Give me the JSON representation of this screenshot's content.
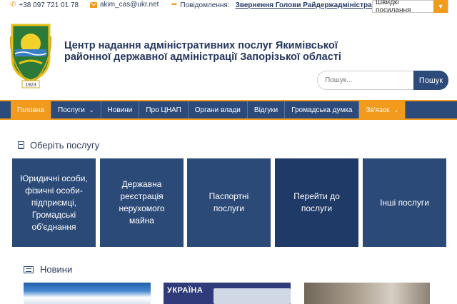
{
  "topbar": {
    "phone": "+38 097 721 01 78",
    "email": "akim_cas@ukr.net",
    "notice_label": "Повідомлення:",
    "notice_link": "Звернення Голови Райдержадміністрації",
    "quick_links": "Швидкі посилання"
  },
  "header": {
    "title_line1": "Центр надання адміністративних послуг Якимівської",
    "title_line2": "районної державної адміністрації Запорізької області",
    "logo_year": "1923",
    "search_placeholder": "Пошук...",
    "search_button": "Пошук"
  },
  "nav": {
    "items": [
      "Головна",
      "Послуги",
      "Новини",
      "Про ЦНАП",
      "Органи влади",
      "Відгуки",
      "Громадська думка",
      "Зв'язок"
    ]
  },
  "services": {
    "heading": "Оберіть послугу",
    "tiles": [
      "Юридичні особи, фізичні особи-підприємці, Громадські об'єднання",
      "Державна реєстрація нерухомого майна",
      "Паспортні послуги",
      "Перейти до послуги",
      "Інші послуги"
    ]
  },
  "news": {
    "heading": "Новини",
    "thumb2_text": "УКРАЇНА"
  },
  "colors": {
    "primary": "#2c4a7a",
    "accent": "#f29a1b"
  }
}
